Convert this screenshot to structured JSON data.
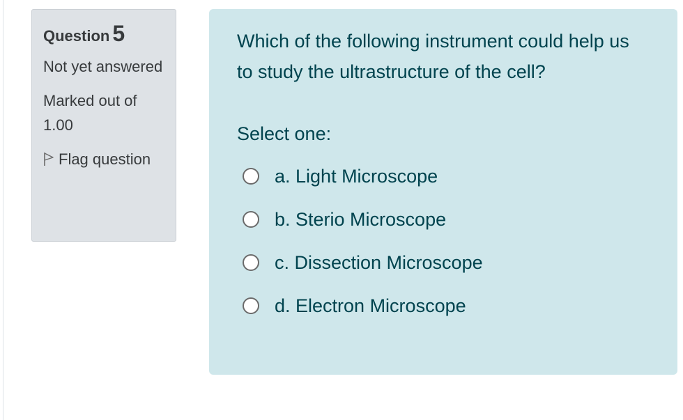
{
  "info": {
    "question_label": "Question",
    "question_number": "5",
    "state": "Not yet answered",
    "grade": "Marked out of 1.00",
    "flag_label": "Flag question"
  },
  "question": {
    "text": "Which of the following instrument could help us to study the ultrastructure of the cell?",
    "prompt": "Select one:",
    "options": [
      {
        "label": "a. Light Microscope"
      },
      {
        "label": "b. Sterio Microscope"
      },
      {
        "label": "c. Dissection Microscope"
      },
      {
        "label": "d. Electron Microscope"
      }
    ]
  },
  "colors": {
    "info_background": "#dee2e6",
    "question_background": "#cfe7eb",
    "question_text": "#00434e"
  },
  "icons": [
    "flag-icon",
    "radio-button"
  ]
}
